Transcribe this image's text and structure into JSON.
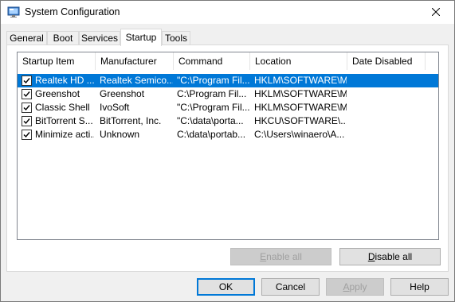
{
  "window": {
    "title": "System Configuration",
    "app_icon": "msconfig-icon",
    "close_icon": "close-icon"
  },
  "tabs": [
    {
      "label": "General",
      "active": false
    },
    {
      "label": "Boot",
      "active": false
    },
    {
      "label": "Services",
      "active": false
    },
    {
      "label": "Startup",
      "active": true
    },
    {
      "label": "Tools",
      "active": false
    }
  ],
  "startup_list": {
    "columns": [
      "Startup Item",
      "Manufacturer",
      "Command",
      "Location",
      "Date Disabled"
    ],
    "rows": [
      {
        "checked": true,
        "selected": true,
        "item": "Realtek HD ...",
        "manufacturer": "Realtek Semico...",
        "command": "\"C:\\Program Fil...",
        "location": "HKLM\\SOFTWARE\\M...",
        "date_disabled": ""
      },
      {
        "checked": true,
        "selected": false,
        "item": "Greenshot",
        "manufacturer": "Greenshot",
        "command": "C:\\Program Fil...",
        "location": "HKLM\\SOFTWARE\\M...",
        "date_disabled": ""
      },
      {
        "checked": true,
        "selected": false,
        "item": "Classic Shell",
        "manufacturer": "IvoSoft",
        "command": "\"C:\\Program Fil...",
        "location": "HKLM\\SOFTWARE\\M...",
        "date_disabled": ""
      },
      {
        "checked": true,
        "selected": false,
        "item": "BitTorrent S...",
        "manufacturer": "BitTorrent, Inc.",
        "command": "\"C:\\data\\porta...",
        "location": "HKCU\\SOFTWARE\\...",
        "date_disabled": ""
      },
      {
        "checked": true,
        "selected": false,
        "item": "Minimize acti...",
        "manufacturer": "Unknown",
        "command": "C:\\data\\portab...",
        "location": "C:\\Users\\winaero\\A...",
        "date_disabled": ""
      }
    ]
  },
  "panel_buttons": {
    "enable_all": {
      "label": "Enable all",
      "mnemonic": "E",
      "rest": "nable all",
      "disabled": true
    },
    "disable_all": {
      "label": "Disable all",
      "mnemonic": "D",
      "rest": "isable all",
      "disabled": false
    }
  },
  "dialog_buttons": {
    "ok": "OK",
    "cancel": "Cancel",
    "apply": {
      "label": "Apply",
      "mnemonic": "A",
      "rest": "pply",
      "disabled": true
    },
    "help": "Help"
  },
  "colors": {
    "selection": "#0078d7",
    "dialog_bg": "#f0f0f0",
    "disabled_text": "#a0a0a0"
  }
}
